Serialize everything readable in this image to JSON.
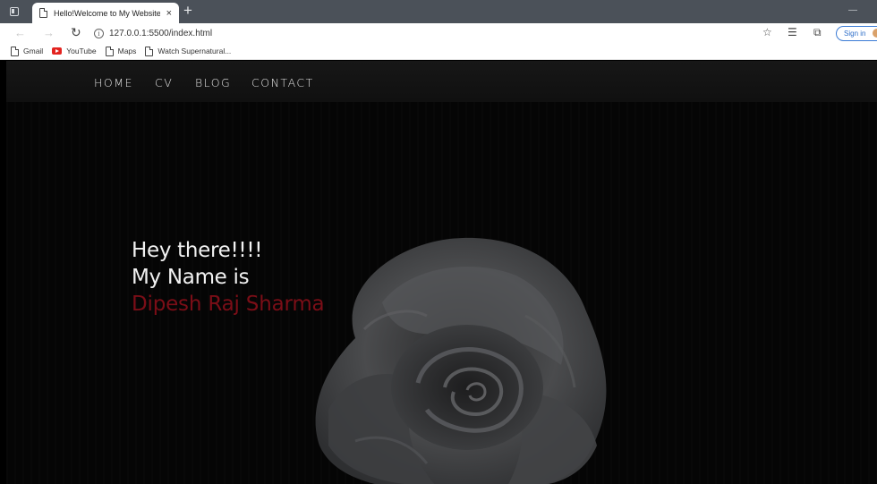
{
  "browser": {
    "tab_title": "Hello!Welcome to My Website",
    "tab_close": "×",
    "new_tab": "+",
    "url": "127.0.0.1:5500/index.html",
    "sign_in": "Sign in",
    "icons": [
      "sidebar-toggle-icon",
      "page-icon",
      "back-arrow-icon",
      "forward-arrow-icon",
      "reload-icon",
      "info-icon",
      "favorite-star-icon",
      "favorites-list-icon",
      "collections-icon"
    ]
  },
  "bookmarks": [
    {
      "label": "Gmail",
      "icon": "page-icon"
    },
    {
      "label": "YouTube",
      "icon": "youtube-icon"
    },
    {
      "label": "Maps",
      "icon": "page-icon"
    },
    {
      "label": "Watch Supernatural...",
      "icon": "page-icon"
    }
  ],
  "site": {
    "nav": [
      "HOME",
      "CV",
      "BLOG",
      "CONTACT"
    ],
    "hero_line1": "Hey there!!!!",
    "hero_line2": "My Name is",
    "hero_name": "Dipesh Raj Sharma"
  },
  "colors": {
    "name_accent": "#7b0e17",
    "page_background": "#050505",
    "tab_strip": "#4b5159"
  }
}
